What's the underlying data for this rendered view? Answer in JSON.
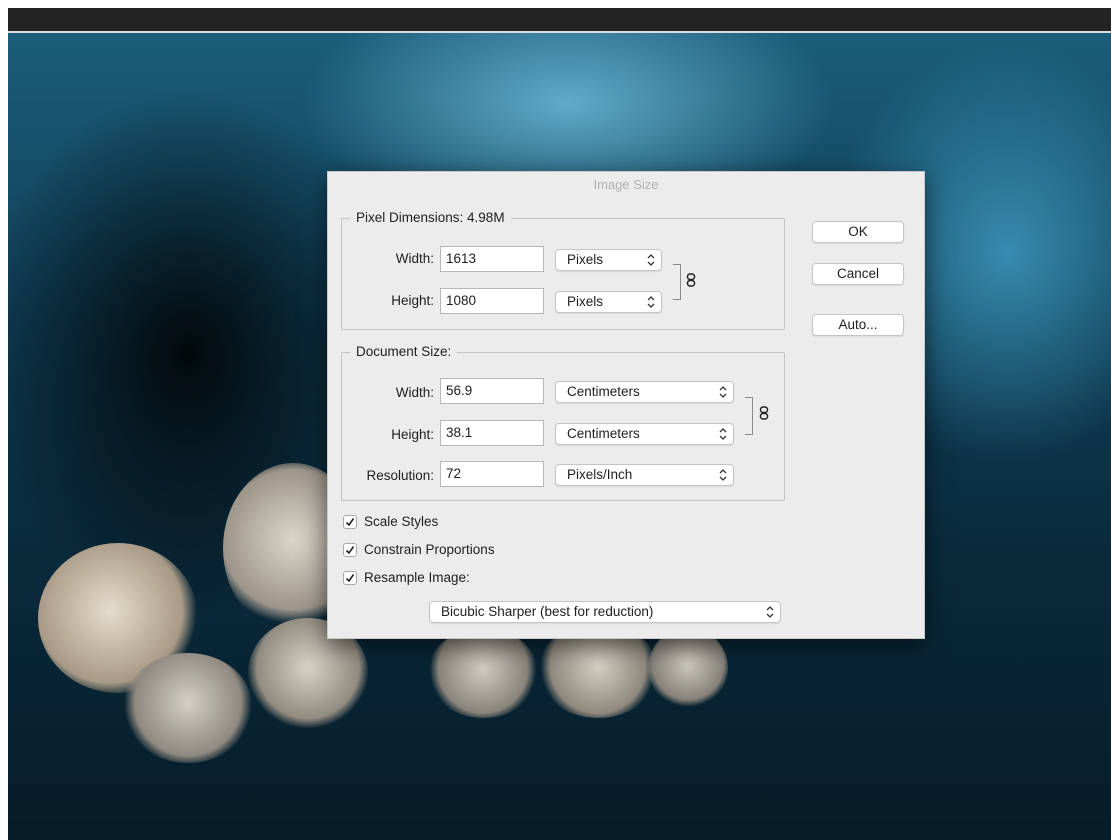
{
  "dialog": {
    "title": "Image Size"
  },
  "pixel_dimensions": {
    "legend": "Pixel Dimensions:  4.98M",
    "width_label": "Width:",
    "width_value": "1613",
    "width_unit": "Pixels",
    "height_label": "Height:",
    "height_value": "1080",
    "height_unit": "Pixels"
  },
  "document_size": {
    "legend": "Document Size:",
    "width_label": "Width:",
    "width_value": "56.9",
    "width_unit": "Centimeters",
    "height_label": "Height:",
    "height_value": "38.1",
    "height_unit": "Centimeters",
    "resolution_label": "Resolution:",
    "resolution_value": "72",
    "resolution_unit": "Pixels/Inch"
  },
  "buttons": {
    "ok": "OK",
    "cancel": "Cancel",
    "auto": "Auto..."
  },
  "options": {
    "scale_styles": {
      "label": "Scale Styles",
      "checked": true
    },
    "constrain_proportions": {
      "label": "Constrain Proportions",
      "checked": true
    },
    "resample_image": {
      "label": "Resample Image:",
      "checked": true
    }
  },
  "resample_method": "Bicubic Sharper (best for reduction)",
  "icons": {
    "chevron": "up-down-chevron-icon",
    "link": "chain-link-icon",
    "checkmark": "checkmark-icon"
  }
}
